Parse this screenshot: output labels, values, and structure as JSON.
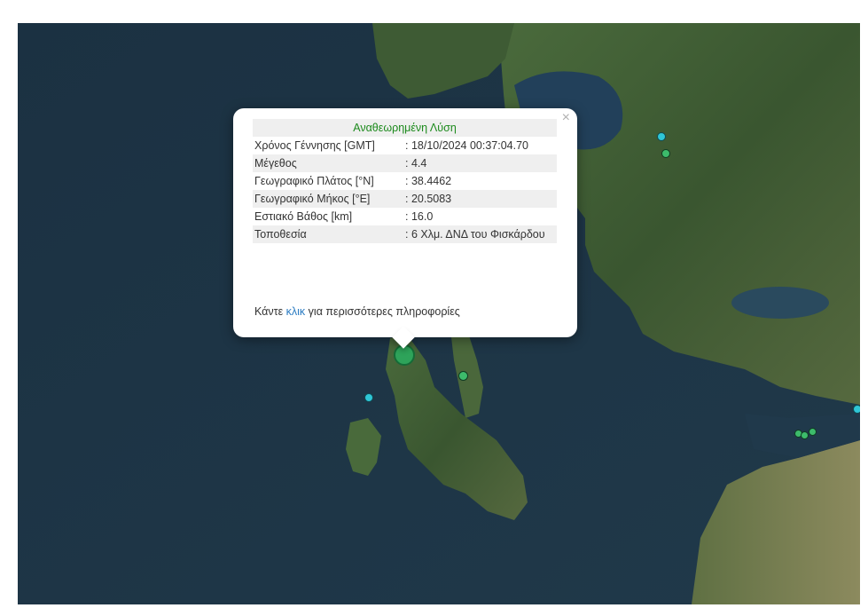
{
  "popup": {
    "title": "Αναθεωρημένη Λύση",
    "close_glyph": "×",
    "rows": [
      {
        "label": "Χρόνος Γέννησης [GMT]",
        "value": ": 18/10/2024 00:37:04.70"
      },
      {
        "label": "Μέγεθος",
        "value": ": 4.4"
      },
      {
        "label": "Γεωγραφικό Πλάτος [°N]",
        "value": ": 38.4462"
      },
      {
        "label": "Γεωγραφικό Μήκος [°E]",
        "value": ": 20.5083"
      },
      {
        "label": "Εστιακό Βάθος [km]",
        "value": ": 16.0"
      },
      {
        "label": "Τοποθεσία",
        "value": ": 6 Χλμ. ΔΝΔ του Φισκάρδου"
      }
    ],
    "footer_prefix": "Κάντε ",
    "footer_link": "κλικ",
    "footer_suffix": " για περισσότερες πληροφορίες"
  },
  "colors": {
    "sea": "#1d3444",
    "land": "#3b5a33",
    "title_green": "#1c8a1c",
    "link_blue": "#2a7bc2",
    "marker_cyan": "#2fc6d6",
    "marker_green": "#3dbb6b"
  }
}
